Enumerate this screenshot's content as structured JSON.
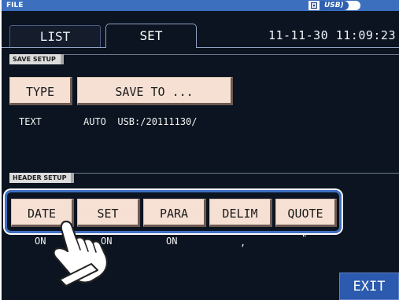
{
  "titlebar": {
    "title": "FILE",
    "media_label": "USB)"
  },
  "tabs": {
    "list": "LIST",
    "set": "SET"
  },
  "datetime": "11-11-30 11:09:23",
  "save_setup": {
    "section_label": "SAVE SETUP",
    "type_button": "TYPE",
    "save_to_button": "SAVE TO ...",
    "type_value": "TEXT",
    "save_to_value": "AUTO  USB:/20111130/"
  },
  "header_setup": {
    "section_label": "HEADER SETUP",
    "buttons": [
      {
        "label": "DATE",
        "value": "ON"
      },
      {
        "label": "SET",
        "value": "ON"
      },
      {
        "label": "PARA",
        "value": "ON"
      },
      {
        "label": "DELIM",
        "value": ","
      },
      {
        "label": "QUOTE",
        "value": "\""
      }
    ]
  },
  "exit_button": "EXIT",
  "icons": {
    "media": "sd-card-icon",
    "pointer": "hand-pointer-icon"
  },
  "colors": {
    "accent": "#3c6fbe",
    "button": "#f6e0d4",
    "background": "#0b1420"
  }
}
